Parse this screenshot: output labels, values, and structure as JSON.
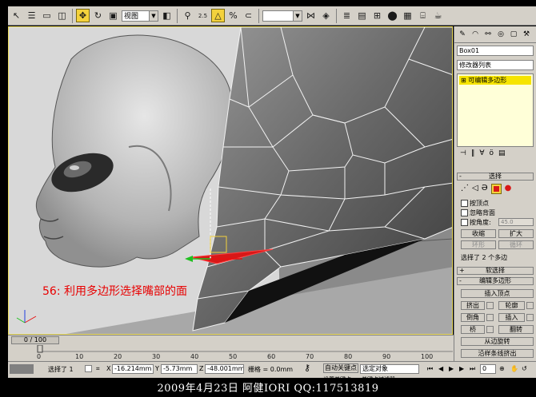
{
  "toolbar": {
    "view_select": "视图",
    "snap_angle_label": "2.5",
    "percent_snap_label": "%"
  },
  "viewport": {
    "caption": "56: 利用多边形选择嘴部的面"
  },
  "panel": {
    "object_name": "Box01",
    "modifier_list_label": "修改器列表",
    "stack_item": "可编辑多边形",
    "selection_header": "选择",
    "by_vertex_label": "按顶点",
    "ignore_backfacing_label": "忽略背面",
    "by_angle_label": "按角度:",
    "angle_value": "45.0",
    "shrink_button": "收缩",
    "grow_button": "扩大",
    "ring_button": "环形",
    "loop_button": "循环",
    "selection_info": "选择了 2 个多边",
    "soft_selection_header": "软选择",
    "edit_polygons_header": "编辑多边形",
    "insert_vertex_button": "插入顶点",
    "extrude_button": "挤出",
    "outline_button": "轮廓",
    "bevel_button": "倒角",
    "inset_button": "插入",
    "bridge_button": "桥",
    "flip_button": "翻转",
    "hinge_from_edge_button": "从边旋转",
    "extrude_along_spline_button": "沿样条线挤出"
  },
  "timeline": {
    "frame_indicator": "0 / 100",
    "ticks": [
      "0",
      "10",
      "20",
      "30",
      "40",
      "50",
      "60",
      "70",
      "80",
      "90",
      "100"
    ]
  },
  "status": {
    "selection_count": "选择了 1",
    "x_label": "X",
    "x_value": "-16.214mm",
    "y_label": "Y",
    "y_value": "-5.73mm",
    "z_label": "Z",
    "z_value": "-48.001mm",
    "grid_label": "栅格 = 0.0mm",
    "auto_key_label": "自动关键点",
    "selected_dropdown": "选定对象",
    "set_key_label": "设置关键点",
    "key_filters_label": "关键点过滤器",
    "frame_value": "0"
  },
  "footer": {
    "credit": "2009年4月23日  阿健IORI  QQ:117513819"
  },
  "colors": {
    "ui_gray": "#d4d0c8",
    "selection_yellow": "#f6e400",
    "caption_red": "#e80000",
    "selected_face_red": "#d81818"
  }
}
